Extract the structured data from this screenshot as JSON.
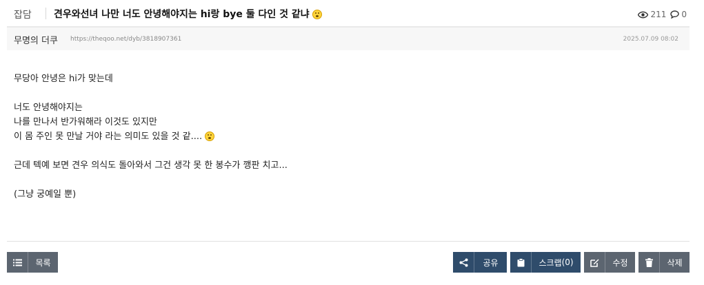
{
  "post": {
    "category": "잡담",
    "title": "견우와선녀 나만 너도 안녕해야지는 hi랑 bye 둘 다인 것 같냐",
    "views": "211",
    "comments": "0",
    "author": "무명의 더쿠",
    "url": "https://theqoo.net/dyb/3818907361",
    "date": "2025.07.09 08:02"
  },
  "content": {
    "lines": [
      "무당아 안녕은 hi가 맞는데",
      "",
      "너도 안녕해야지는",
      "나를 만나서 반가워해라 이것도 있지만",
      "이 몸 주인 못 만날 거야 라는 의미도 있을 것 같....",
      "",
      "근데 텍예 보면 견우 의식도 돌아와서 그건 생각 못 한 봉수가 깽판 치고...",
      "",
      "(그냥 궁예일 뿐)"
    ]
  },
  "actions": {
    "list": "목록",
    "share": "공유",
    "scrap": "스크랩",
    "scrap_count": "(0)",
    "edit": "수정",
    "delete": "삭제"
  },
  "icons": [
    "eye-icon",
    "comment-icon",
    "list-icon",
    "share-icon",
    "clipboard-icon",
    "edit-icon",
    "trash-icon",
    "emoji-icon"
  ],
  "colors": {
    "button_gray": "#5c6570",
    "button_navy": "#2f4c6b"
  }
}
